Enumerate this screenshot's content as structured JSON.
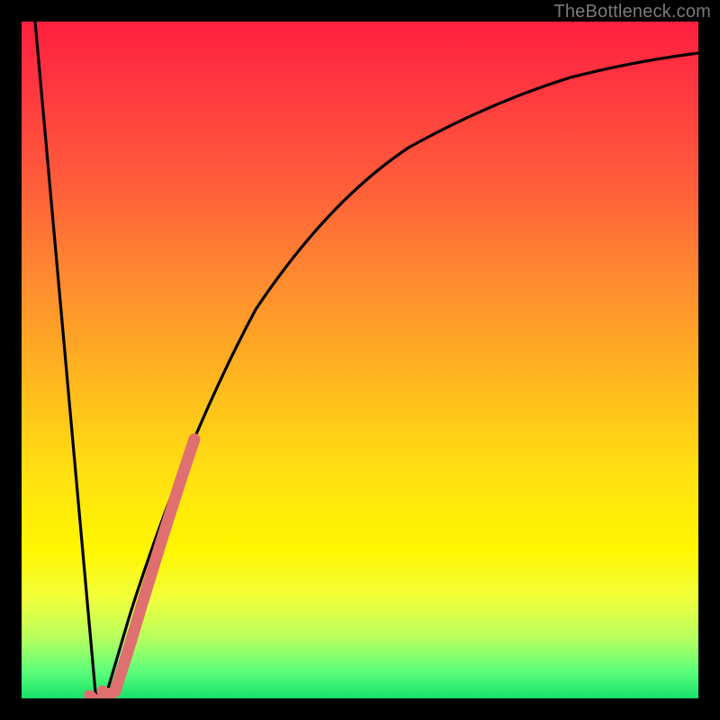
{
  "watermark": "TheBottleneck.com",
  "chart_data": {
    "type": "line",
    "title": "",
    "xlabel": "",
    "ylabel": "",
    "xlim": [
      0,
      100
    ],
    "ylim": [
      0,
      100
    ],
    "grid": false,
    "legend": false,
    "background_gradient": [
      "#ff1f3e",
      "#ff8a30",
      "#ffde12",
      "#fff600",
      "#18e06a"
    ],
    "series": [
      {
        "name": "main-curve",
        "color": "#000000",
        "x": [
          2,
          4,
          6,
          8,
          10,
          11,
          12,
          14,
          16,
          18,
          20,
          24,
          28,
          32,
          36,
          40,
          45,
          50,
          55,
          60,
          65,
          70,
          75,
          80,
          85,
          90,
          95,
          100
        ],
        "y": [
          100,
          78,
          56,
          34,
          12,
          0,
          4,
          18,
          30,
          40,
          48,
          60,
          68,
          74,
          78,
          81,
          84,
          86.5,
          88.5,
          90,
          91.2,
          92.2,
          93,
          93.7,
          94.3,
          94.8,
          95.2,
          95.5
        ]
      },
      {
        "name": "highlight-segment",
        "color": "#e27474",
        "stroke_width": 10,
        "x": [
          12,
          14,
          16,
          18,
          20,
          22,
          24,
          26
        ],
        "y": [
          2,
          2,
          8,
          18,
          26,
          33,
          38,
          42
        ]
      }
    ],
    "annotations": []
  }
}
